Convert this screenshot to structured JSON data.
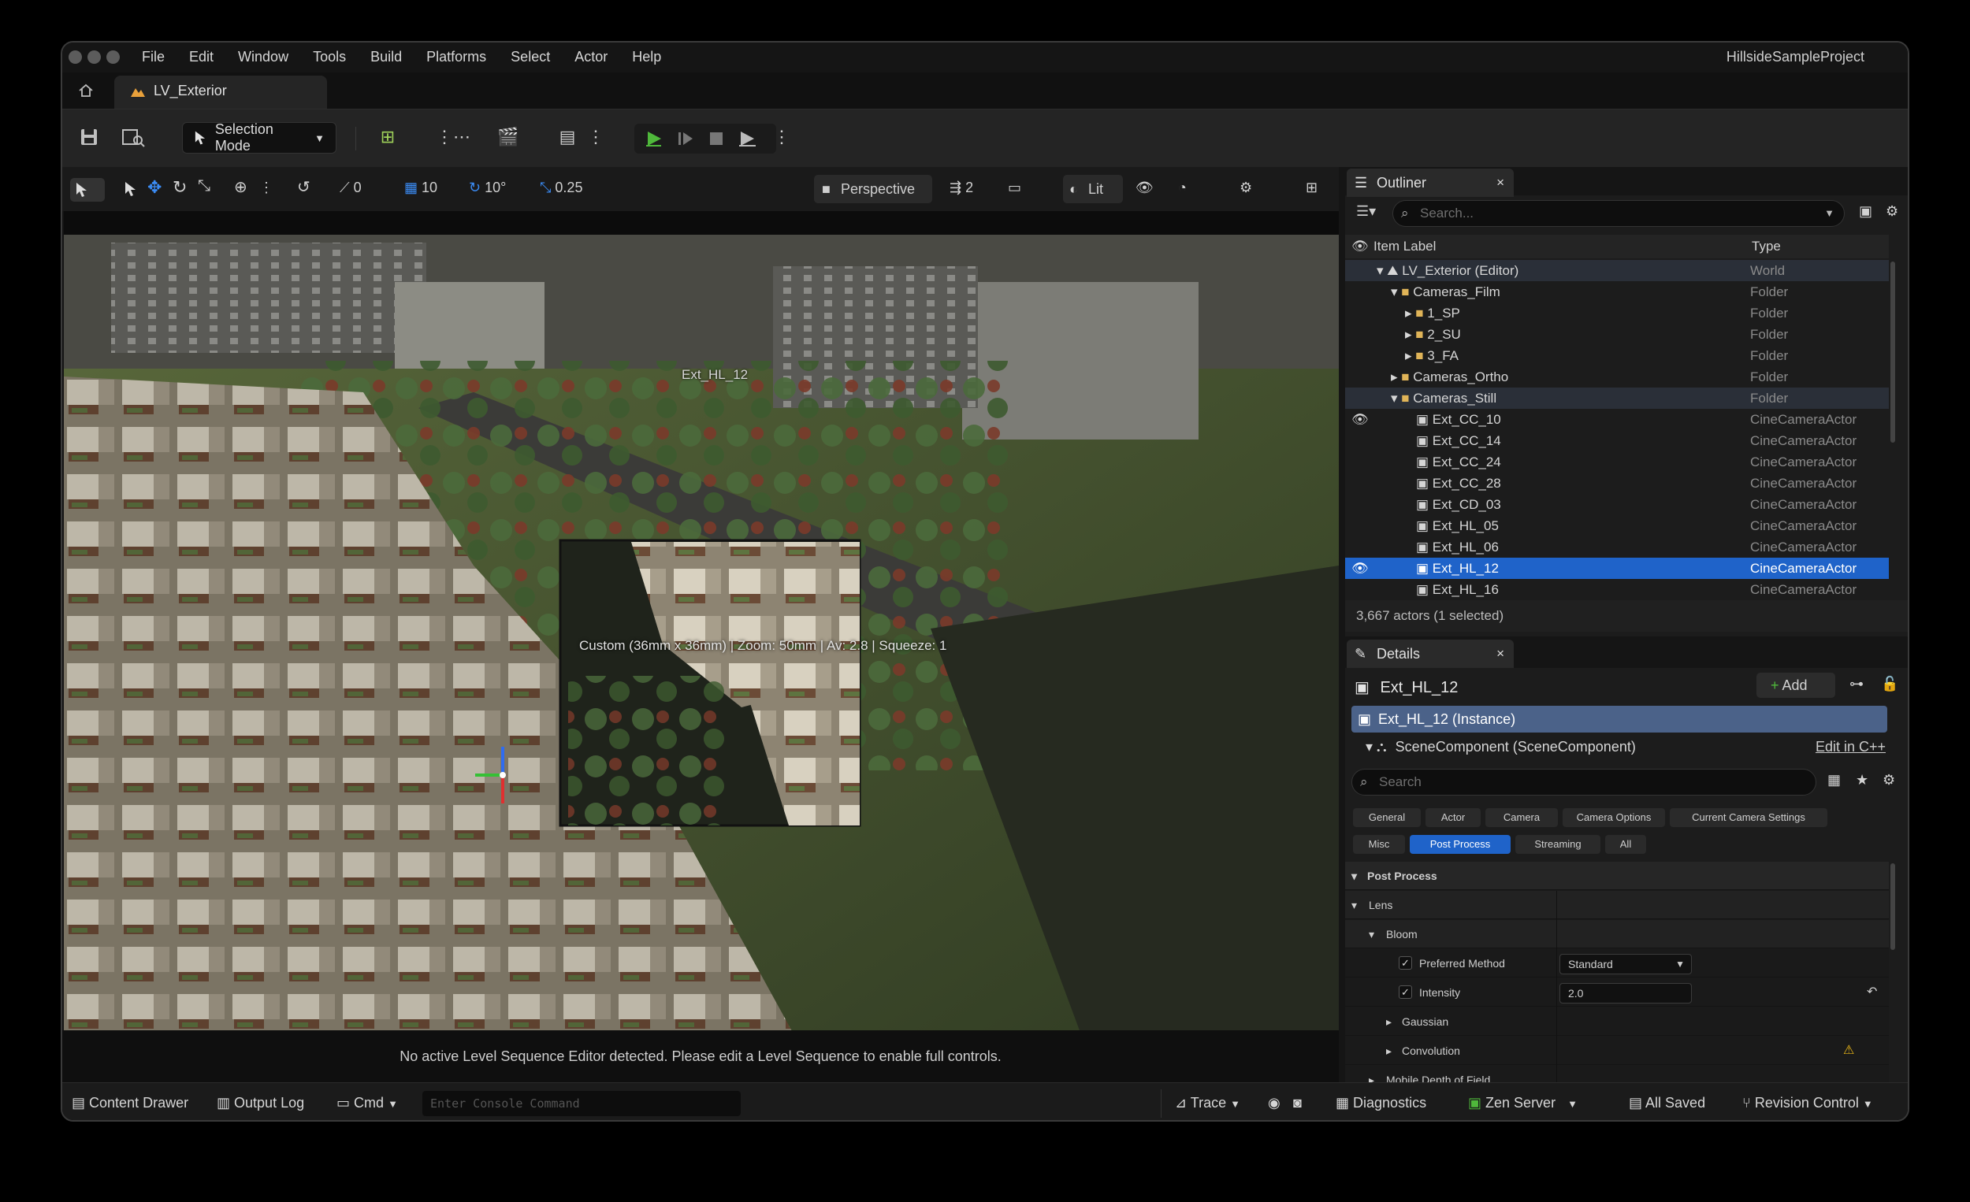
{
  "menu": [
    "File",
    "Edit",
    "Window",
    "Tools",
    "Build",
    "Platforms",
    "Select",
    "Actor",
    "Help"
  ],
  "project_name": "HillsideSampleProject",
  "level_tab": "LV_Exterior",
  "toolbar": {
    "selection_mode": "Selection Mode"
  },
  "viewport_toolbar": {
    "rotate_snap": "0",
    "grid_snap": "10",
    "angle_snap": "10°",
    "scale_snap": "0.25",
    "view_mode": "Perspective",
    "camera_speed": "2",
    "lighting": "Lit"
  },
  "viewport": {
    "camera_label": "Ext_HL_12",
    "camera_info": "Custom (36mm x 36mm) | Zoom: 50mm | Av: 2.8 | Squeeze: 1",
    "status_message": "No active Level Sequence Editor detected. Please edit a Level Sequence to enable full controls."
  },
  "outliner": {
    "tab": "Outliner",
    "search_placeholder": "Search...",
    "col_label": "Item Label",
    "col_type": "Type",
    "rows": [
      {
        "label": "LV_Exterior (Editor)",
        "type": "World"
      },
      {
        "label": "Cameras_Film",
        "type": "Folder"
      },
      {
        "label": "1_SP",
        "type": "Folder"
      },
      {
        "label": "2_SU",
        "type": "Folder"
      },
      {
        "label": "3_FA",
        "type": "Folder"
      },
      {
        "label": "Cameras_Ortho",
        "type": "Folder"
      },
      {
        "label": "Cameras_Still",
        "type": "Folder"
      },
      {
        "label": "Ext_CC_10",
        "type": "CineCameraActor"
      },
      {
        "label": "Ext_CC_14",
        "type": "CineCameraActor"
      },
      {
        "label": "Ext_CC_24",
        "type": "CineCameraActor"
      },
      {
        "label": "Ext_CC_28",
        "type": "CineCameraActor"
      },
      {
        "label": "Ext_CD_03",
        "type": "CineCameraActor"
      },
      {
        "label": "Ext_HL_05",
        "type": "CineCameraActor"
      },
      {
        "label": "Ext_HL_06",
        "type": "CineCameraActor"
      },
      {
        "label": "Ext_HL_12",
        "type": "CineCameraActor"
      },
      {
        "label": "Ext_HL_16",
        "type": "CineCameraActor"
      }
    ],
    "status": "3,667 actors (1 selected)"
  },
  "details": {
    "tab": "Details",
    "actor_name": "Ext_HL_12",
    "add_label": "Add",
    "instance_label": "Ext_HL_12 (Instance)",
    "component_label": "SceneComponent (SceneComponent)",
    "edit_link": "Edit in C++",
    "search_placeholder": "Search",
    "filter_tabs": [
      "General",
      "Actor",
      "Camera",
      "Camera Options",
      "Current Camera Settings",
      "Misc",
      "Post Process",
      "Streaming",
      "All"
    ],
    "active_filter": "Post Process",
    "section": "Post Process",
    "lens": "Lens",
    "bloom": "Bloom",
    "preferred_method_label": "Preferred Method",
    "preferred_method_value": "Standard",
    "intensity_label": "Intensity",
    "intensity_value": "2.0",
    "gaussian": "Gaussian",
    "convolution": "Convolution",
    "mobile_dof": "Mobile Depth of Field"
  },
  "bottombar": {
    "content_drawer": "Content Drawer",
    "output_log": "Output Log",
    "cmd": "Cmd",
    "console_placeholder": "Enter Console Command",
    "trace": "Trace",
    "diagnostics": "Diagnostics",
    "zen_server": "Zen Server",
    "all_saved": "All Saved",
    "revision_control": "Revision Control"
  },
  "colors": {
    "accent": "#1f63c9",
    "play": "#4fb83b",
    "warning": "#e7b416"
  }
}
